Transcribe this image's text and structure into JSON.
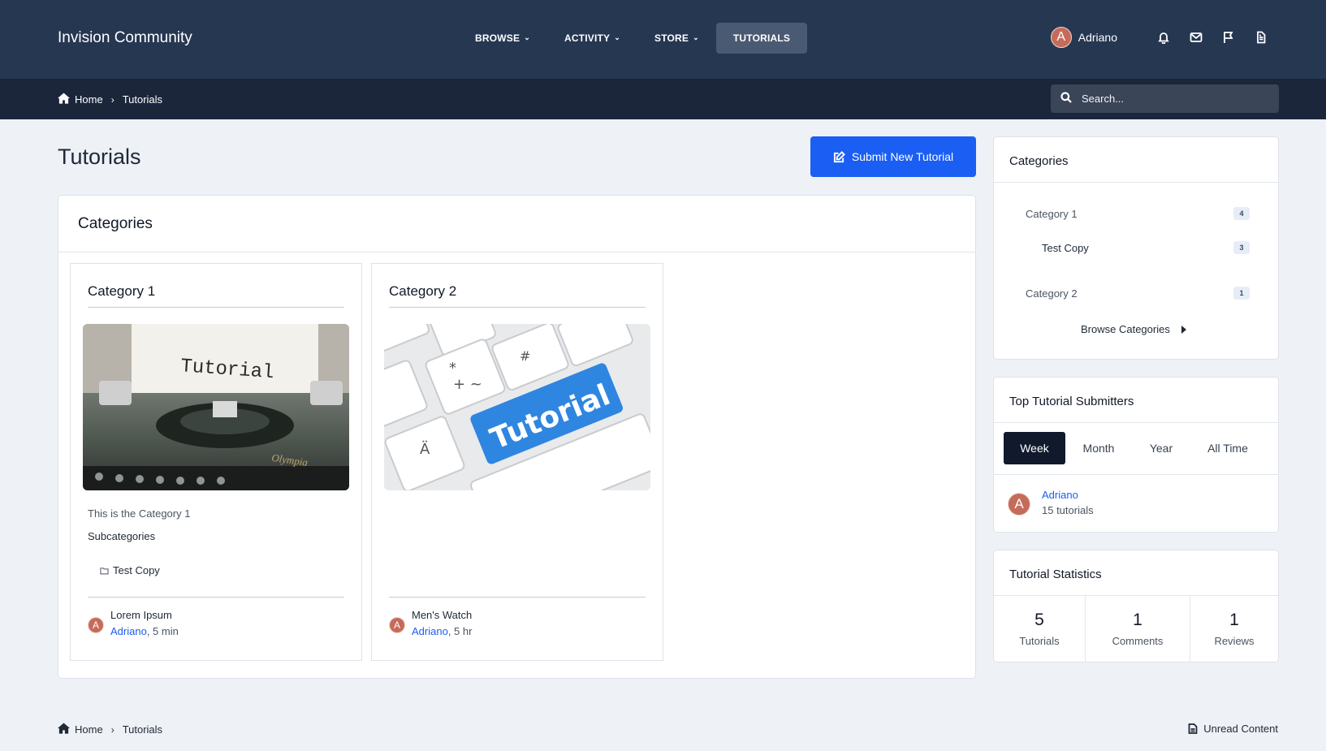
{
  "site": {
    "title": "Invision Community"
  },
  "nav": {
    "items": [
      {
        "label": "BROWSE",
        "dropdown": true,
        "active": false
      },
      {
        "label": "ACTIVITY",
        "dropdown": true,
        "active": false
      },
      {
        "label": "STORE",
        "dropdown": true,
        "active": false
      },
      {
        "label": "TUTORIALS",
        "dropdown": false,
        "active": true
      }
    ]
  },
  "user": {
    "initial": "A",
    "name": "Adriano",
    "icons": [
      "bell-icon",
      "envelope-icon",
      "flag-icon",
      "document-icon"
    ]
  },
  "breadcrumb": {
    "home": "Home",
    "current": "Tutorials"
  },
  "search": {
    "placeholder": "Search..."
  },
  "page": {
    "title": "Tutorials",
    "submit_label": "Submit New Tutorial"
  },
  "categories_panel": {
    "heading": "Categories",
    "cards": [
      {
        "title": "Category 1",
        "image_text": "Tutorial",
        "description": "This is the Category 1",
        "subcategories_label": "Subcategories",
        "subcategories": [
          "Test Copy"
        ],
        "latest": {
          "title": "Lorem Ipsum",
          "author": "Adriano",
          "time": ", 5 min",
          "avatar": "A"
        }
      },
      {
        "title": "Category 2",
        "image_text": "Tutorial",
        "description": "",
        "subcategories_label": "",
        "subcategories": [],
        "latest": {
          "title": "Men's Watch",
          "author": "Adriano",
          "time": ", 5 hr",
          "avatar": "A"
        }
      }
    ]
  },
  "sidebar": {
    "categories": {
      "heading": "Categories",
      "items": [
        {
          "label": "Category 1",
          "count": "4"
        },
        {
          "label": "Test Copy",
          "count": "3"
        },
        {
          "label": "Category 2",
          "count": "1"
        }
      ],
      "browse_label": "Browse Categories"
    },
    "top_submitters": {
      "heading": "Top Tutorial Submitters",
      "tabs": [
        "Week",
        "Month",
        "Year",
        "All Time"
      ],
      "active_tab": "Week",
      "entries": [
        {
          "avatar": "A",
          "name": "Adriano",
          "count": "15 tutorials"
        }
      ]
    },
    "statistics": {
      "heading": "Tutorial Statistics",
      "items": [
        {
          "value": "5",
          "label": "Tutorials"
        },
        {
          "value": "1",
          "label": "Comments"
        },
        {
          "value": "1",
          "label": "Reviews"
        }
      ]
    }
  },
  "footer": {
    "home": "Home",
    "current": "Tutorials",
    "unread_label": "Unread Content"
  },
  "colors": {
    "header": "#263752",
    "subbar": "#1b263b",
    "accent": "#1a5ef3",
    "background": "#eef1f6"
  }
}
